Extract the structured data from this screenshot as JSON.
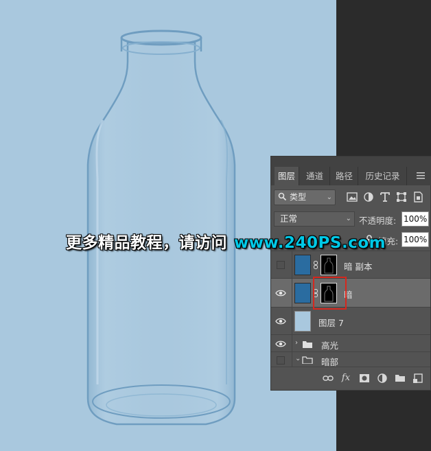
{
  "watermark": {
    "text_cn": "更多精品教程，请访问",
    "url": "www.240PS.com"
  },
  "panel": {
    "tabs": [
      {
        "label": "图层",
        "active": true
      },
      {
        "label": "通道",
        "active": false
      },
      {
        "label": "路径",
        "active": false
      },
      {
        "label": "历史记录",
        "active": false
      }
    ],
    "filter": {
      "type_label": "类型",
      "icons": [
        "image-filter-icon",
        "adjustment-filter-icon",
        "text-filter-icon",
        "shape-filter-icon",
        "smart-object-filter-icon"
      ]
    },
    "blend_mode": "正常",
    "opacity_label": "不透明度:",
    "opacity_value": "100%",
    "fill_label": "填充:",
    "fill_value": "100%",
    "layers": [
      {
        "name": "暗 副本",
        "visible": false,
        "selected": false,
        "thumb_color": "#2a6ca0",
        "has_mask": true
      },
      {
        "name": "暗",
        "visible": true,
        "selected": true,
        "thumb_color": "#2a6ca0",
        "has_mask": true
      },
      {
        "name": "图层 7",
        "visible": true,
        "selected": false,
        "thumb_color": "#a9c8de",
        "has_mask": false
      },
      {
        "name": "高光",
        "visible": true,
        "selected": false,
        "type": "group",
        "expanded": false
      },
      {
        "name": "暗部",
        "visible": false,
        "selected": false,
        "type": "group",
        "expanded": true
      }
    ],
    "bottom_icons": [
      "link-layers-icon",
      "fx-icon",
      "add-mask-icon",
      "adjustment-layer-icon",
      "new-group-icon",
      "new-layer-icon"
    ],
    "fx_label": "fx"
  },
  "colors": {
    "canvas_bg": "#a9c8de",
    "panel_bg": "#535353",
    "selected_row": "#6b6b6b",
    "highlight": "#d6281e",
    "url_color": "#00c8e6"
  }
}
